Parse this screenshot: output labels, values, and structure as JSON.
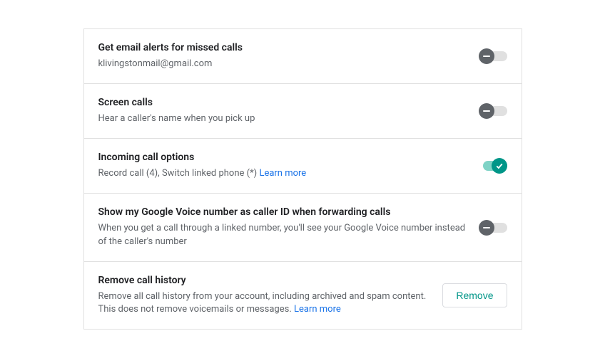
{
  "settings": {
    "emailAlerts": {
      "title": "Get email alerts for missed calls",
      "description": "klivingstonmail@gmail.com",
      "enabled": false
    },
    "screenCalls": {
      "title": "Screen calls",
      "description": "Hear a caller's name when you pick up",
      "enabled": false
    },
    "incomingOptions": {
      "title": "Incoming call options",
      "description": "Record call (4), Switch linked phone (*) ",
      "learnMore": "Learn more",
      "enabled": true
    },
    "callerId": {
      "title": "Show my Google Voice number as caller ID when forwarding calls",
      "description": "When you get a call through a linked number, you'll see your Google Voice number instead of the caller's number",
      "enabled": false
    },
    "removeHistory": {
      "title": "Remove call history",
      "description": "Remove all call history from your account, including archived and spam content. This does not remove voicemails or messages. ",
      "learnMore": "Learn more",
      "buttonLabel": "Remove"
    }
  }
}
